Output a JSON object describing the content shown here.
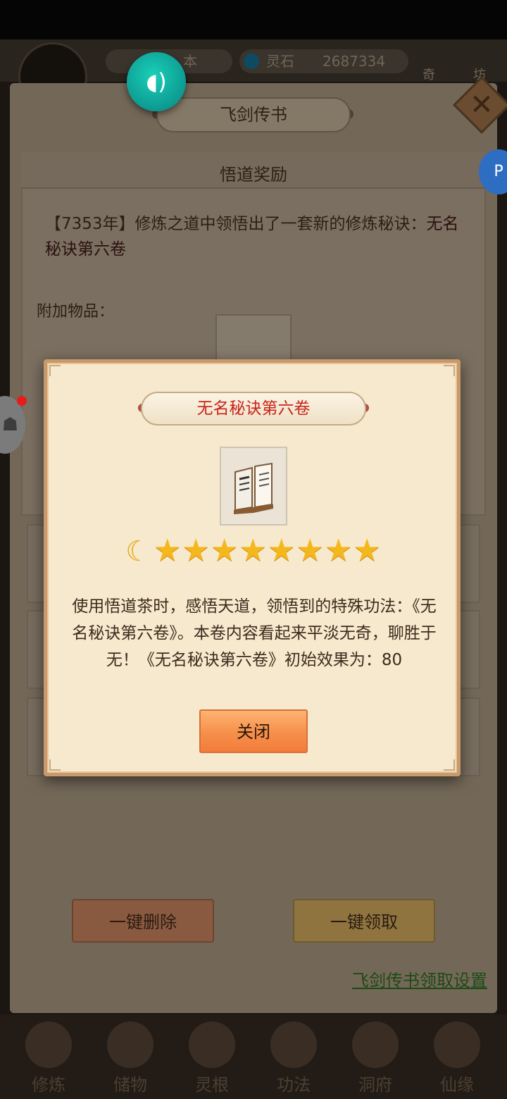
{
  "top_bar": {
    "res1_label": "本",
    "res2_label": "灵石",
    "res2_value": "2687334",
    "right_tag_1": "奇",
    "right_tag_2": "坊"
  },
  "panel": {
    "title": "飞剑传书",
    "reward_title": "悟道奖励",
    "reward_message_prefix": "【7353年】修炼之道中领悟出了一套新的修炼秘诀：",
    "reward_message_highlight": "无名秘诀第六卷",
    "attach_label": "附加物品：",
    "delete_all_label": "一键删除",
    "collect_all_label": "一键领取",
    "settings_link": "飞剑传书领取设置"
  },
  "modal": {
    "title": "无名秘诀第六卷",
    "stars": 8,
    "moon": 1,
    "description": "使用悟道茶时，感悟天道，领悟到的特殊功法：《无名秘诀第六卷》。本卷内容看起来平淡无奇，聊胜于无！《无名秘诀第六卷》初始效果为：80",
    "close_label": "关闭"
  },
  "bottom_nav": [
    {
      "label": "修炼"
    },
    {
      "label": "储物"
    },
    {
      "label": "灵根"
    },
    {
      "label": "功法"
    },
    {
      "label": "洞府"
    },
    {
      "label": "仙缘"
    }
  ],
  "icons": {
    "sound": "sound-icon",
    "close": "close-x-icon",
    "book": "book-icon",
    "moon": "moon-icon",
    "star": "star-icon"
  },
  "colors": {
    "modal_title": "#c8241c",
    "accent_button": "#f58f4a",
    "link": "#1d4a14"
  }
}
